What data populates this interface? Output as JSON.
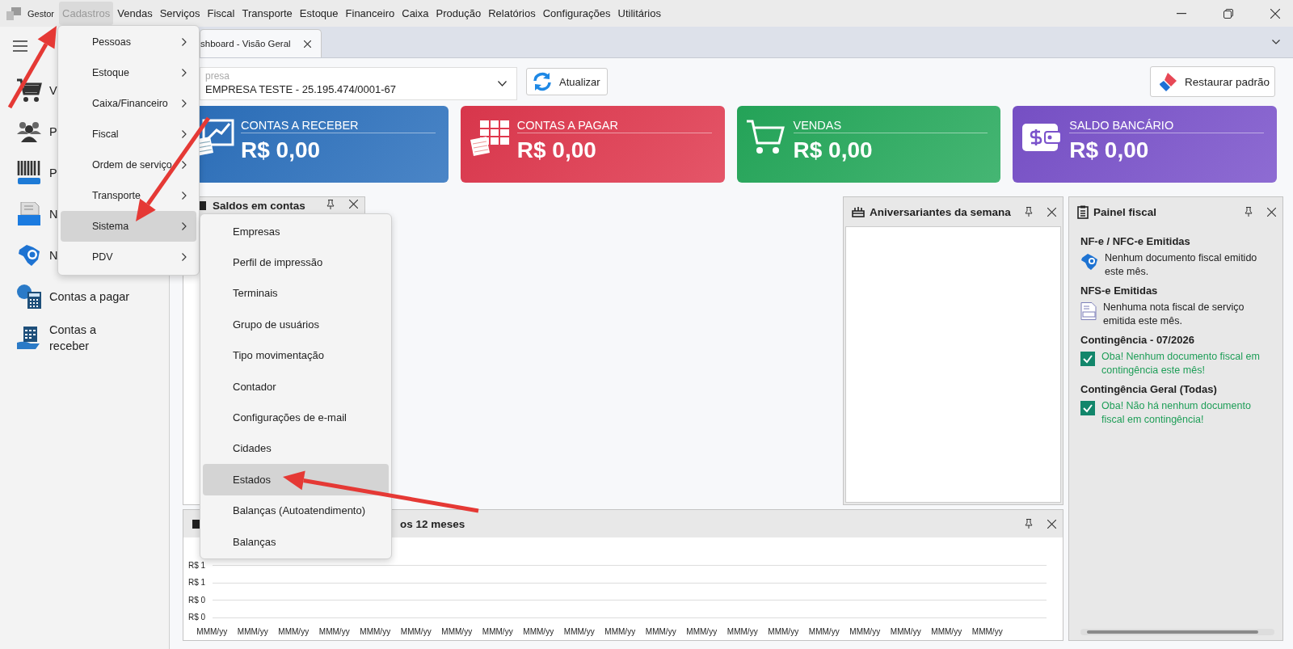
{
  "menubar": {
    "app_name": "Gestor",
    "items": [
      {
        "label": "Cadastros",
        "selected": true
      },
      {
        "label": "Vendas",
        "selected": false
      },
      {
        "label": "Serviços",
        "selected": false
      },
      {
        "label": "Fiscal",
        "selected": false
      },
      {
        "label": "Transporte",
        "selected": false
      },
      {
        "label": "Estoque",
        "selected": false
      },
      {
        "label": "Financeiro",
        "selected": false
      },
      {
        "label": "Caixa",
        "selected": false
      },
      {
        "label": "Produção",
        "selected": false
      },
      {
        "label": "Relatórios",
        "selected": false
      },
      {
        "label": "Configurações",
        "selected": false
      },
      {
        "label": "Utilitários",
        "selected": false
      }
    ]
  },
  "cadastros_menu": {
    "items": [
      {
        "label": "Pessoas",
        "selected": false
      },
      {
        "label": "Estoque",
        "selected": false
      },
      {
        "label": "Caixa/Financeiro",
        "selected": false
      },
      {
        "label": "Fiscal",
        "selected": false
      },
      {
        "label": "Ordem de serviço",
        "selected": false
      },
      {
        "label": "Transporte",
        "selected": false
      },
      {
        "label": "Sistema",
        "selected": true
      },
      {
        "label": "PDV",
        "selected": false
      }
    ]
  },
  "sistema_submenu": {
    "items": [
      {
        "label": "Empresas",
        "selected": false
      },
      {
        "label": "Perfil de impressão",
        "selected": false
      },
      {
        "label": "Terminais",
        "selected": false
      },
      {
        "label": "Grupo de usuários",
        "selected": false
      },
      {
        "label": "Tipo movimentação",
        "selected": false
      },
      {
        "label": "Contador",
        "selected": false
      },
      {
        "label": "Configurações de e-mail",
        "selected": false
      },
      {
        "label": "Cidades",
        "selected": false
      },
      {
        "label": "Estados",
        "selected": true
      },
      {
        "label": "Balanças (Autoatendimento)",
        "selected": false
      },
      {
        "label": "Balanças",
        "selected": false
      }
    ]
  },
  "sidebar": {
    "items": [
      {
        "kind": "cart",
        "label": "V"
      },
      {
        "kind": "people",
        "label": "P"
      },
      {
        "kind": "barcode",
        "label": "P"
      },
      {
        "kind": "nfse",
        "label": "N"
      },
      {
        "kind": "nfe",
        "label": "N"
      },
      {
        "kind": "payable",
        "label": "Contas a pagar"
      },
      {
        "kind": "receivable",
        "label": "Contas a receber"
      }
    ]
  },
  "tabs": [
    {
      "label": "shboard - Visão Geral",
      "selected": true
    }
  ],
  "toolbar": {
    "company_field": {
      "label": "presa",
      "value": "EMPRESA TESTE - 25.195.474/0001-67"
    },
    "refresh_button": "Atualizar",
    "restore_button": "Restaurar padrão"
  },
  "cards": [
    {
      "kind": "receivable",
      "title": "CONTAS A RECEBER",
      "value": "R$ 0,00",
      "color": "#2b70bd"
    },
    {
      "kind": "payable",
      "title": "CONTAS A PAGAR",
      "value": "R$ 0,00",
      "color": "#e0384e"
    },
    {
      "kind": "sales",
      "title": "VENDAS",
      "value": "R$ 0,00",
      "color": "#25a95b"
    },
    {
      "kind": "bank",
      "title": "SALDO BANCÁRIO",
      "value": "R$ 0,00",
      "color": "#7a52cb"
    }
  ],
  "balances_panel": {
    "title": "Saldos em contas"
  },
  "birthdays_panel": {
    "title": "Aniversariantes da semana"
  },
  "fiscal_panel": {
    "title": "Painel fiscal",
    "sections": [
      {
        "kind": "nfe",
        "heading": "NF-e / NFC-e Emitidas",
        "message": "Nenhum documento fiscal emitido este mês."
      },
      {
        "kind": "nfse",
        "heading": "NFS-e Emitidas",
        "message": "Nenhuma nota fiscal de serviço emitida este mês."
      },
      {
        "kind": "ok",
        "heading": "Contingência - 07/2026",
        "message": "Oba! Nenhum documento fiscal em contingência este mês!"
      },
      {
        "kind": "ok",
        "heading": "Contingência Geral (Todas)",
        "message": "Oba! Não há nenhum documento fiscal em contingência!"
      }
    ]
  },
  "chart_panel": {
    "title": "os 12 meses",
    "y_labels": [
      "R$ 1",
      "R$ 1",
      "R$ 0",
      "R$ 0"
    ],
    "x_labels": [
      "MMM/yy",
      "MMM/yy",
      "MMM/yy",
      "MMM/yy",
      "MMM/yy",
      "MMM/yy",
      "MMM/yy",
      "MMM/yy",
      "MMM/yy",
      "MMM/yy",
      "MMM/yy",
      "MMM/yy",
      "MMM/yy",
      "MMM/yy",
      "MMM/yy",
      "MMM/yy",
      "MMM/yy",
      "MMM/yy",
      "MMM/yy",
      "MMM/yy"
    ]
  }
}
